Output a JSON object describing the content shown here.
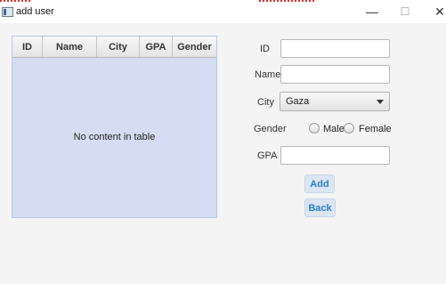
{
  "window": {
    "title": "add user",
    "minimize_glyph": "—",
    "maximize_glyph": "☐",
    "close_glyph": "✕"
  },
  "table": {
    "columns": [
      "ID",
      "Name",
      "City",
      "GPA",
      "Gender"
    ],
    "empty_text": "No content in table"
  },
  "form": {
    "id_label": "ID",
    "id_value": "",
    "name_label": "Name",
    "name_value": "",
    "city_label": "City",
    "city_selected": "Gaza",
    "gender_label": "Gender",
    "gender_options": [
      "Male",
      "Female"
    ],
    "gpa_label": "GPA",
    "gpa_value": ""
  },
  "buttons": {
    "add": "Add",
    "back": "Back"
  },
  "colors": {
    "table_background": "#d5dcf4",
    "button_text": "#2d7fc0",
    "button_background": "#dbe6f3"
  }
}
